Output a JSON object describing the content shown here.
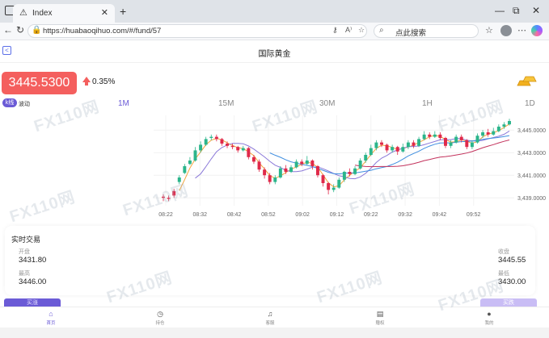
{
  "browser": {
    "tab_title": "Index",
    "tab_close": "✕",
    "new_tab": "+",
    "url": "https://huabaoqihuo.com/#/fund/57",
    "url_read_aloud": "A⁾",
    "search_placeholder": "点此搜索",
    "window_controls": [
      "—",
      "⧉",
      "✕"
    ]
  },
  "header": {
    "back": "<",
    "title": "国际黄金"
  },
  "quote": {
    "price": "3445.5300",
    "change": "0.35%",
    "up_color": "#f45f5e"
  },
  "chart_tabs": {
    "kline": "k线",
    "wave": "波动",
    "periods": [
      "1M",
      "15M",
      "30M",
      "1H",
      "1D"
    ],
    "active_period": "1M"
  },
  "chart_data": {
    "type": "candlestick",
    "x_ticks": [
      "08:22",
      "08:32",
      "08:42",
      "08:52",
      "09:02",
      "09:12",
      "09:22",
      "09:32",
      "09:42",
      "09:52"
    ],
    "y_ticks": [
      "3,439.0000",
      "3,441.0000",
      "3,443.0000",
      "3,445.0000"
    ],
    "ylim": [
      3438.3,
      3446.3
    ],
    "colors": {
      "up": "#2bb58b",
      "down": "#e0294a",
      "ma1": "#f3a43a",
      "ma2": "#3f8ee0",
      "ma3": "#8a78d8",
      "ma4": "#c3325c"
    },
    "candles": [
      [
        3439.1,
        3439.0,
        3439.3,
        3438.7
      ],
      [
        3439.0,
        3438.9,
        3439.2,
        3438.7
      ],
      [
        3439.6,
        3439.2,
        3439.8,
        3439.0
      ],
      [
        3440.4,
        3440.8,
        3441.0,
        3440.2
      ],
      [
        3441.2,
        3441.8,
        3442.0,
        3441.1
      ],
      [
        3442.0,
        3442.3,
        3442.6,
        3441.9
      ],
      [
        3442.3,
        3443.2,
        3443.5,
        3442.2
      ],
      [
        3443.2,
        3443.7,
        3444.0,
        3443.0
      ],
      [
        3443.7,
        3444.2,
        3444.4,
        3443.6
      ],
      [
        3444.3,
        3444.4,
        3444.6,
        3444.1
      ],
      [
        3444.4,
        3444.2,
        3444.6,
        3444.0
      ],
      [
        3444.2,
        3443.8,
        3444.3,
        3443.6
      ],
      [
        3443.8,
        3443.6,
        3444.0,
        3443.4
      ],
      [
        3443.6,
        3443.5,
        3443.8,
        3443.3
      ],
      [
        3443.5,
        3443.2,
        3443.6,
        3443.0
      ],
      [
        3443.2,
        3443.4,
        3443.6,
        3443.1
      ],
      [
        3443.4,
        3442.6,
        3443.5,
        3442.4
      ],
      [
        3442.6,
        3442.2,
        3442.8,
        3442.0
      ],
      [
        3442.2,
        3441.5,
        3442.4,
        3441.3
      ],
      [
        3441.5,
        3441.0,
        3441.7,
        3440.7
      ],
      [
        3441.0,
        3440.4,
        3441.2,
        3440.2
      ],
      [
        3440.4,
        3440.8,
        3441.0,
        3440.2
      ],
      [
        3440.8,
        3441.6,
        3441.8,
        3440.7
      ],
      [
        3441.6,
        3441.3,
        3441.9,
        3441.1
      ],
      [
        3441.3,
        3441.7,
        3441.9,
        3441.2
      ],
      [
        3441.7,
        3442.2,
        3442.4,
        3441.6
      ],
      [
        3442.2,
        3442.0,
        3442.4,
        3441.8
      ],
      [
        3442.0,
        3442.3,
        3442.7,
        3441.9
      ],
      [
        3442.3,
        3441.8,
        3442.4,
        3441.5
      ],
      [
        3441.8,
        3441.0,
        3441.9,
        3440.8
      ],
      [
        3441.0,
        3440.3,
        3441.1,
        3440.0
      ],
      [
        3440.3,
        3439.7,
        3440.4,
        3439.3
      ],
      [
        3439.7,
        3439.9,
        3440.2,
        3439.5
      ],
      [
        3439.9,
        3440.6,
        3440.8,
        3439.8
      ],
      [
        3440.6,
        3441.3,
        3441.4,
        3440.4
      ],
      [
        3441.3,
        3441.1,
        3441.6,
        3440.9
      ],
      [
        3441.1,
        3441.6,
        3441.8,
        3441.0
      ],
      [
        3441.6,
        3442.3,
        3442.5,
        3441.5
      ],
      [
        3442.3,
        3442.8,
        3443.0,
        3442.1
      ],
      [
        3442.8,
        3443.4,
        3443.7,
        3442.7
      ],
      [
        3443.4,
        3443.9,
        3444.1,
        3443.2
      ],
      [
        3443.9,
        3443.7,
        3444.1,
        3443.5
      ],
      [
        3443.7,
        3443.2,
        3443.8,
        3443.0
      ],
      [
        3443.2,
        3443.5,
        3443.7,
        3443.0
      ],
      [
        3443.5,
        3443.1,
        3443.6,
        3442.8
      ],
      [
        3443.1,
        3443.5,
        3443.8,
        3443.0
      ],
      [
        3443.5,
        3443.9,
        3444.1,
        3443.3
      ],
      [
        3443.9,
        3443.6,
        3444.1,
        3443.4
      ],
      [
        3443.6,
        3444.2,
        3444.4,
        3443.5
      ],
      [
        3444.2,
        3444.6,
        3444.9,
        3444.1
      ],
      [
        3444.6,
        3444.4,
        3444.8,
        3444.2
      ],
      [
        3444.4,
        3444.6,
        3444.9,
        3444.3
      ],
      [
        3444.6,
        3444.3,
        3444.8,
        3444.1
      ],
      [
        3444.3,
        3443.6,
        3444.4,
        3443.4
      ],
      [
        3443.6,
        3443.9,
        3444.1,
        3443.4
      ],
      [
        3443.9,
        3444.4,
        3444.6,
        3443.8
      ],
      [
        3444.4,
        3444.1,
        3444.6,
        3443.9
      ],
      [
        3444.1,
        3443.5,
        3444.2,
        3443.3
      ],
      [
        3443.5,
        3443.9,
        3444.1,
        3443.3
      ],
      [
        3443.9,
        3444.5,
        3444.7,
        3443.8
      ],
      [
        3444.5,
        3444.8,
        3445.0,
        3444.3
      ],
      [
        3444.8,
        3444.6,
        3445.1,
        3444.4
      ],
      [
        3444.6,
        3444.9,
        3445.2,
        3444.5
      ],
      [
        3444.9,
        3445.3,
        3445.5,
        3444.8
      ],
      [
        3445.3,
        3445.5,
        3445.7,
        3445.1
      ],
      [
        3445.5,
        3445.8,
        3446.0,
        3445.4
      ]
    ]
  },
  "realtime": {
    "title": "实时交易",
    "open_label": "开盘",
    "open": "3431.80",
    "high_label": "最高",
    "high": "3446.00",
    "close_label": "收盘",
    "close": "3445.55",
    "low_label": "最低",
    "low": "3430.00"
  },
  "actions": {
    "left": "买涨",
    "right": "买跌"
  },
  "bottom_nav": [
    {
      "label": "首页",
      "icon": "home-icon"
    },
    {
      "label": "持仓",
      "icon": "clock-icon"
    },
    {
      "label": "客服",
      "icon": "support-icon"
    },
    {
      "label": "赠权",
      "icon": "document-icon"
    },
    {
      "label": "我的",
      "icon": "user-icon"
    }
  ],
  "watermark": "FX110网"
}
